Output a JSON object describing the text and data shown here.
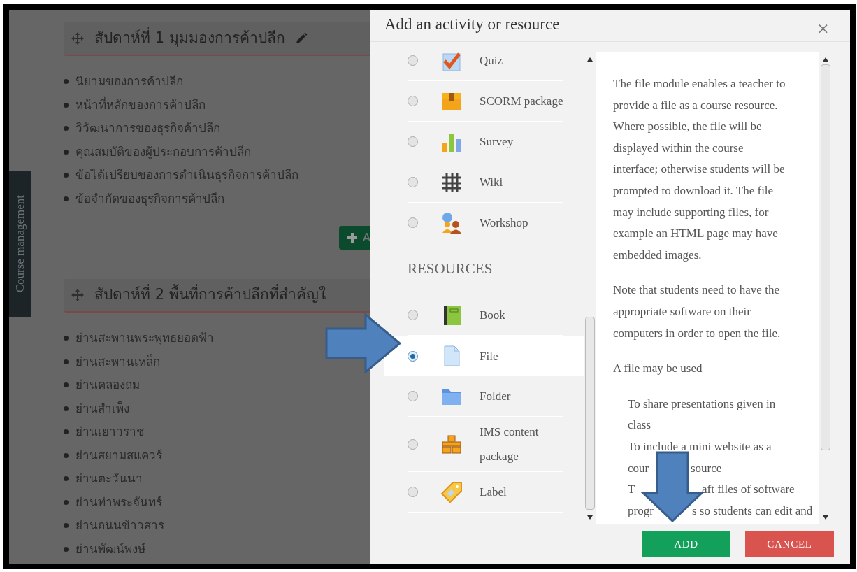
{
  "page": {
    "sections": [
      {
        "title": "สัปดาห์ที่ 1 มุมมองการค้าปลีก",
        "editable": true,
        "items": [
          "นิยามของการค้าปลีก",
          "หน้าที่หลักของการค้าปลีก",
          "วิวัฒนาการของธุรกิจค้าปลีก",
          "คุณสมบัติของผู้ประกอบการค้าปลีก",
          "ข้อได้เปรียบของการดำเนินธุรกิจการค้าปลีก",
          "ข้อจำกัดของธุรกิจการค้าปลีก"
        ],
        "add_button": "A"
      },
      {
        "title": "สัปดาห์ที่ 2 พื้นที่การค้าปลีกที่สำคัญใ",
        "editable": false,
        "items": [
          "ย่านสะพานพระพุทธยอดฟ้า",
          "ย่านสะพานเหล็ก",
          "ย่านคลองถม",
          "ย่านสำเพ็ง",
          "ย่านเยาวราช",
          "ย่านสยามสแควร์",
          "ย่านตะวันนา",
          "ย่านท่าพระจันทร์",
          "ย่านถนนข้าวสาร",
          "ย่านพัฒน์พงษ์"
        ]
      }
    ],
    "side_tab": "Course management"
  },
  "dialog": {
    "title": "Add an activity or resource",
    "close": "×",
    "options": [
      {
        "kind": "module",
        "label": "Quiz",
        "selected": false
      },
      {
        "kind": "module",
        "label": "SCORM package",
        "selected": false
      },
      {
        "kind": "module",
        "label": "Survey",
        "selected": false
      },
      {
        "kind": "module",
        "label": "Wiki",
        "selected": false
      },
      {
        "kind": "module",
        "label": "Workshop",
        "selected": false
      },
      {
        "kind": "heading",
        "label": "RESOURCES"
      },
      {
        "kind": "module",
        "label": "Book",
        "selected": false
      },
      {
        "kind": "module",
        "label": "File",
        "selected": true
      },
      {
        "kind": "module",
        "label": "Folder",
        "selected": false
      },
      {
        "kind": "module",
        "label": "IMS content package",
        "selected": false
      },
      {
        "kind": "module",
        "label": "Label",
        "selected": false
      }
    ],
    "description": {
      "paragraphs": [
        "The file module enables a teacher to provide a file as a course resource. Where possible, the file will be displayed within the course interface; otherwise students will be prompted to download it. The file may include supporting files, for example an HTML page may have embedded images.",
        "Note that students need to have the appropriate software on their computers in order to open the file.",
        "A file may be used"
      ],
      "use_lines": [
        [
          "To share presentations given in"
        ],
        [
          "class"
        ],
        [
          "To include a mini website as a"
        ],
        [
          "cour",
          "source"
        ],
        [
          "T",
          "aft files of software"
        ],
        [
          "progr",
          "s so students can edit and"
        ]
      ]
    },
    "buttons": [
      {
        "kind": "primary",
        "label": "ADD"
      },
      {
        "kind": "danger",
        "label": "CANCEL"
      }
    ]
  }
}
